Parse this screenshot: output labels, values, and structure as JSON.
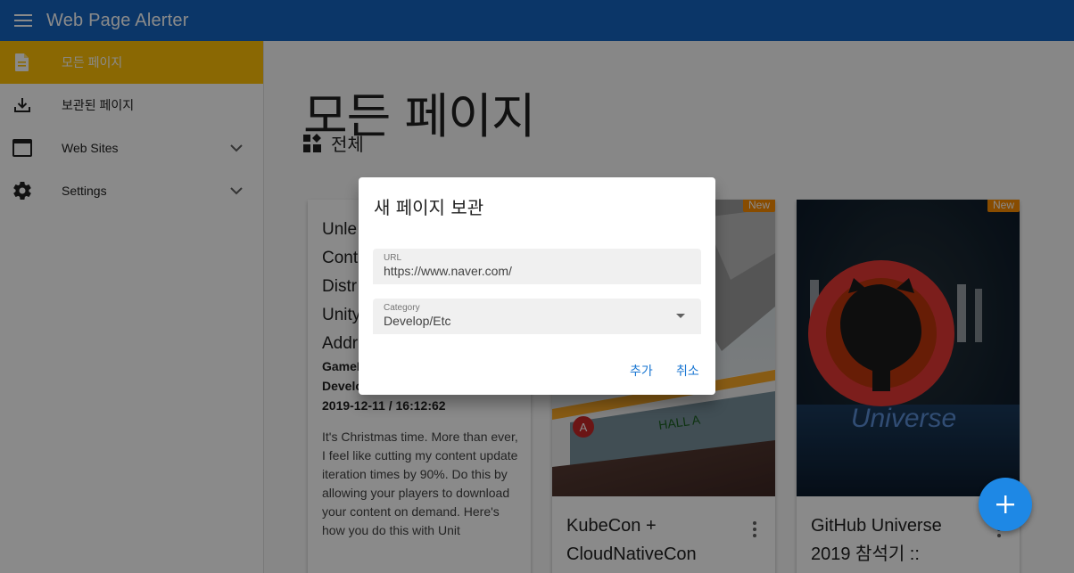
{
  "appbar": {
    "title": "Web Page Alerter",
    "menu_icon": "menu-icon"
  },
  "sidebar": {
    "items": [
      {
        "label": "모든 페이지",
        "icon": "document-icon",
        "active": true
      },
      {
        "label": "보관된 페이지",
        "icon": "download-icon"
      },
      {
        "label": "Web Sites",
        "icon": "browser-window-icon",
        "expandable": true
      },
      {
        "label": "Settings",
        "icon": "gear-icon",
        "expandable": true
      }
    ]
  },
  "main": {
    "title": "모든 페이지",
    "filter": {
      "label": "전체",
      "icon": "dashboard-icon"
    },
    "cards": [
      {
        "title_lines": [
          "Unle",
          "Cont",
          "Distr",
          "Unity",
          "Addr"
        ],
        "meta_lines": [
          "GameD",
          "Develo",
          "2019-12-11 / 16:12:62"
        ],
        "description": "It's Christmas time. More than ever, I feel like cutting my content update iteration times by 90%. Do this by allowing your players to download your content on demand. Here's how you do this with Unit"
      },
      {
        "title_lines": [
          "KubeCon +",
          "CloudNativeCon"
        ],
        "badge": "New",
        "sign_text": "HALL A",
        "sign_letter": "A"
      },
      {
        "title_lines": [
          "GitHub Universe",
          "2019 참석기 ::"
        ],
        "badge": "New",
        "image_text": "Universe"
      }
    ]
  },
  "fab": {
    "icon": "plus-icon"
  },
  "dialog": {
    "title": "새 페이지 보관",
    "url_label": "URL",
    "url_value": "https://www.naver.com/",
    "category_label": "Category",
    "category_value": "Develop/Etc",
    "add_label": "추가",
    "cancel_label": "취소"
  },
  "colors": {
    "appbar": "#1565c0",
    "active_nav": "#ffc107",
    "badge": "#fb8c00",
    "fab": "#1e88e5",
    "action": "#1976d2"
  }
}
